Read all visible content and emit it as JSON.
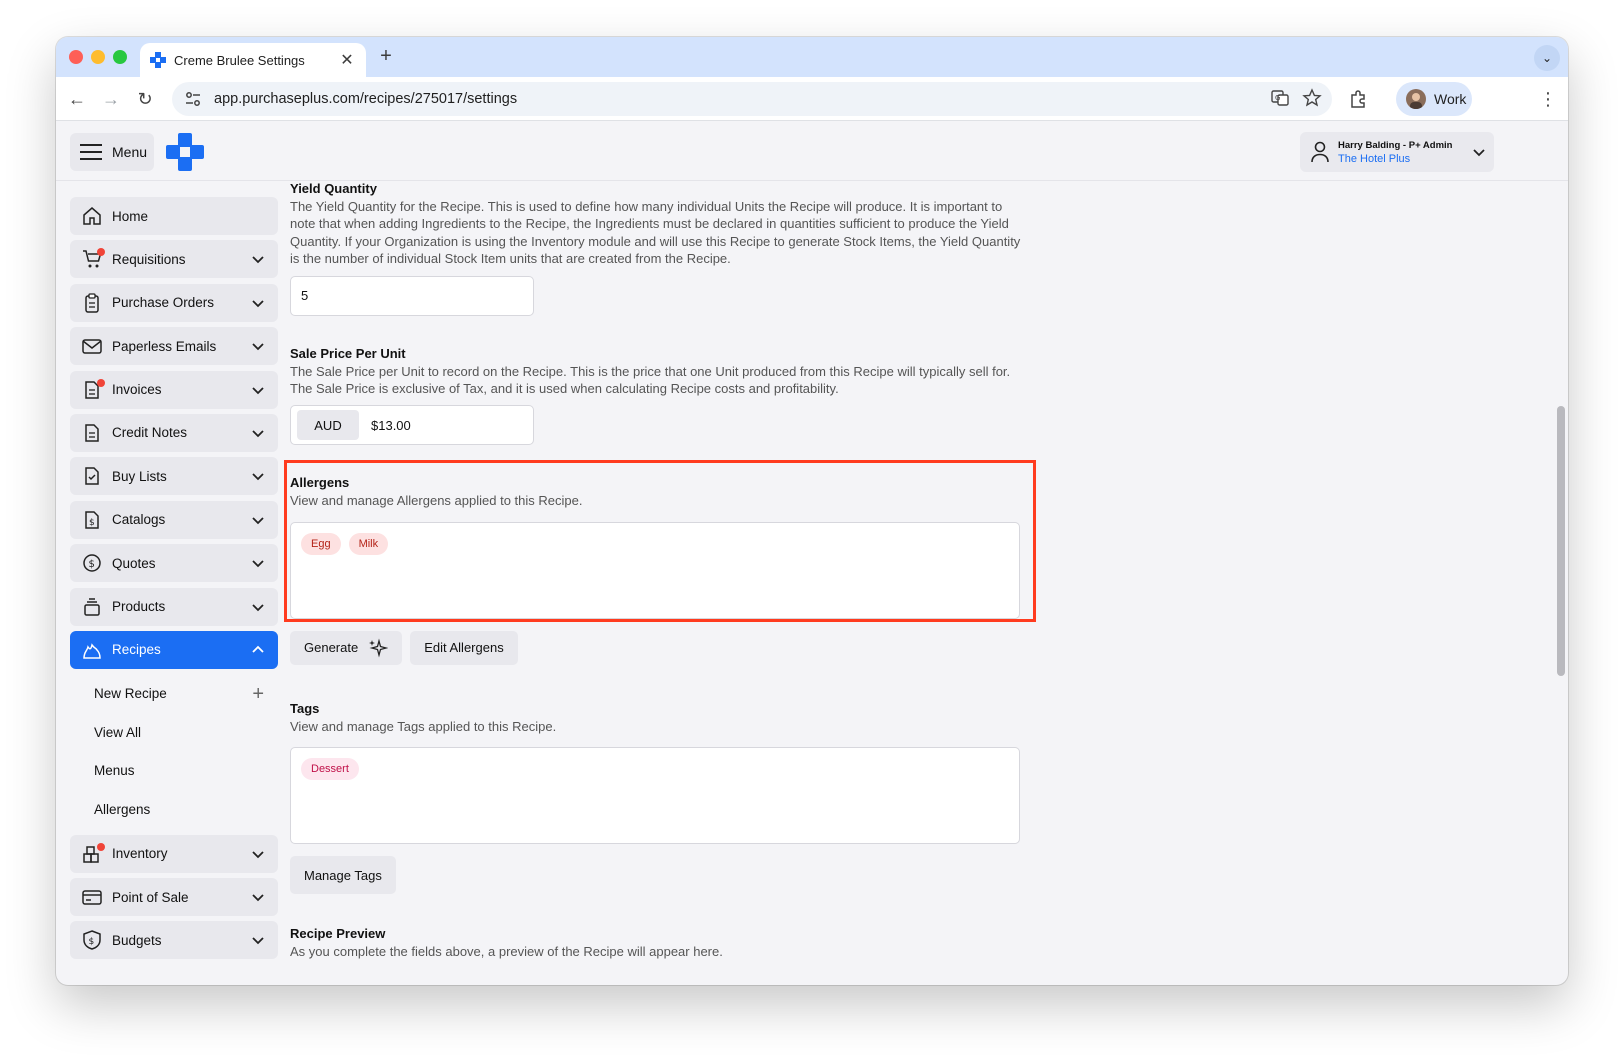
{
  "browser": {
    "tab_title": "Creme Brulee Settings",
    "url": "app.purchaseplus.com/recipes/275017/settings",
    "profile_label": "Work"
  },
  "header": {
    "menu_label": "Menu",
    "user_name": "Harry Balding - P+ Admin",
    "user_org": "The Hotel Plus"
  },
  "sidebar": {
    "items": [
      {
        "label": "Home",
        "icon": "home-icon"
      },
      {
        "label": "Requisitions",
        "icon": "cart-icon"
      },
      {
        "label": "Purchase Orders",
        "icon": "clipboard-icon"
      },
      {
        "label": "Paperless Emails",
        "icon": "envelope-icon"
      },
      {
        "label": "Invoices",
        "icon": "invoice-icon"
      },
      {
        "label": "Credit Notes",
        "icon": "document-icon"
      },
      {
        "label": "Buy Lists",
        "icon": "checklist-icon"
      },
      {
        "label": "Catalogs",
        "icon": "catalog-icon"
      },
      {
        "label": "Quotes",
        "icon": "dollar-circle-icon"
      },
      {
        "label": "Products",
        "icon": "stack-icon"
      },
      {
        "label": "Recipes",
        "icon": "flame-icon"
      },
      {
        "label": "Inventory",
        "icon": "boxes-icon"
      },
      {
        "label": "Point of Sale",
        "icon": "card-icon"
      },
      {
        "label": "Budgets",
        "icon": "shield-dollar-icon"
      }
    ],
    "recipes_sub": [
      "New Recipe",
      "View All",
      "Menus",
      "Allergens"
    ]
  },
  "main": {
    "yield": {
      "title": "Yield Quantity",
      "desc": "The Yield Quantity for the Recipe. This is used to define how many individual Units the Recipe will produce. It is important to note that when adding Ingredients to the Recipe, the Ingredients must be declared in quantities sufficient to produce the Yield Quantity. If your Organization is using the Inventory module and will use this Recipe to generate Stock Items, the Yield Quantity is the number of individual Stock Item units that are created from the Recipe.",
      "value": "5"
    },
    "sale_price": {
      "title": "Sale Price Per Unit",
      "desc": "The Sale Price per Unit to record on the Recipe. This is the price that one Unit produced from this Recipe will typically sell for. The Sale Price is exclusive of Tax, and it is used when calculating Recipe costs and profitability.",
      "currency": "AUD",
      "value": "$13.00"
    },
    "allergens": {
      "title": "Allergens",
      "desc": "View and manage Allergens applied to this Recipe.",
      "items": [
        "Egg",
        "Milk"
      ],
      "generate_label": "Generate",
      "edit_label": "Edit Allergens"
    },
    "tags": {
      "title": "Tags",
      "desc": "View and manage Tags applied to this Recipe.",
      "items": [
        "Dessert"
      ],
      "manage_label": "Manage Tags"
    },
    "preview": {
      "title": "Recipe Preview",
      "desc": "As you complete the fields above, a preview of the Recipe will appear here."
    }
  },
  "colors": {
    "accent": "#1b6ef3",
    "highlight": "#ff3b1f",
    "badge": "#f04438"
  }
}
